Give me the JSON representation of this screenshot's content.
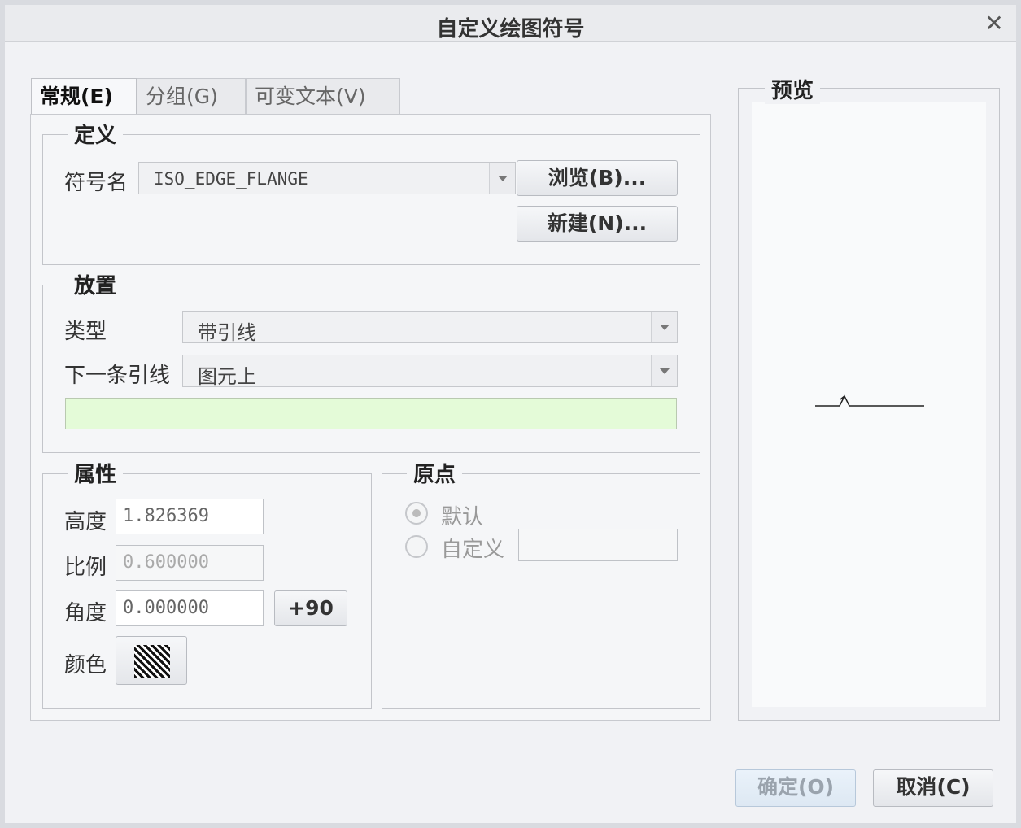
{
  "window": {
    "title": "自定义绘图符号"
  },
  "tabs": [
    {
      "label": "常规(E)"
    },
    {
      "label": "分组(G)"
    },
    {
      "label": "可变文本(V)"
    }
  ],
  "definition": {
    "title": "定义",
    "symbol_name_label": "符号名",
    "symbol_name_value": "ISO_EDGE_FLANGE",
    "browse_label": "浏览(B)...",
    "new_label": "新建(N)..."
  },
  "placement": {
    "title": "放置",
    "type_label": "类型",
    "type_value": "带引线",
    "next_leader_label": "下一条引线",
    "next_leader_value": "图元上"
  },
  "properties": {
    "title": "属性",
    "height_label": "高度",
    "height_value": "1.826369",
    "scale_label": "比例",
    "scale_value": "0.600000",
    "angle_label": "角度",
    "angle_value": "0.000000",
    "plus90_label": "+90",
    "color_label": "颜色"
  },
  "origin": {
    "title": "原点",
    "default_label": "默认",
    "custom_label": "自定义"
  },
  "preview": {
    "title": "预览"
  },
  "footer": {
    "ok_label": "确定(O)",
    "cancel_label": "取消(C)"
  }
}
